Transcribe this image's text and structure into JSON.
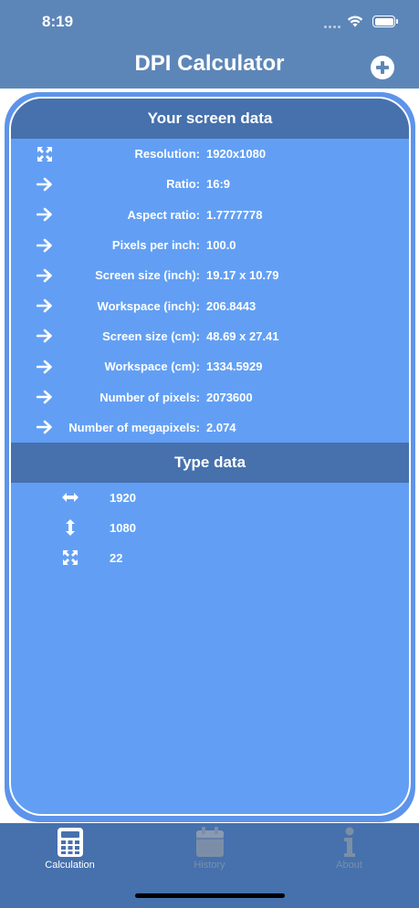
{
  "status_bar": {
    "time": "8:19"
  },
  "header": {
    "title": "DPI Calculator",
    "add_icon": "plus-circle-icon"
  },
  "screen_section": {
    "title": "Your screen data",
    "rows": [
      {
        "icon": "expand-icon",
        "label": "Resolution:",
        "value": "1920x1080"
      },
      {
        "icon": "arrow-right-icon",
        "label": "Ratio:",
        "value": "16:9"
      },
      {
        "icon": "arrow-right-icon",
        "label": "Aspect ratio:",
        "value": "1.7777778"
      },
      {
        "icon": "arrow-right-icon",
        "label": "Pixels per inch:",
        "value": "100.0"
      },
      {
        "icon": "arrow-right-icon",
        "label": "Screen size (inch):",
        "value": "19.17 x 10.79"
      },
      {
        "icon": "arrow-right-icon",
        "label": "Workspace (inch):",
        "value": "206.8443"
      },
      {
        "icon": "arrow-right-icon",
        "label": "Screen size (cm):",
        "value": "48.69 x 27.41"
      },
      {
        "icon": "arrow-right-icon",
        "label": "Workspace (cm):",
        "value": "1334.5929"
      },
      {
        "icon": "arrow-right-icon",
        "label": "Number of pixels:",
        "value": "2073600"
      },
      {
        "icon": "arrow-right-icon",
        "label": "Number of megapixels:",
        "value": "2.074"
      }
    ]
  },
  "type_section": {
    "title": "Type data",
    "rows": [
      {
        "icon": "horizontal-arrows-icon",
        "value": "1920"
      },
      {
        "icon": "vertical-arrows-icon",
        "value": "1080"
      },
      {
        "icon": "expand-icon",
        "value": "22"
      }
    ]
  },
  "tabbar": {
    "tabs": [
      {
        "label": "Calculation",
        "icon": "calculator-icon",
        "active": true
      },
      {
        "label": "History",
        "icon": "calendar-icon",
        "active": false
      },
      {
        "label": "About",
        "icon": "info-icon",
        "active": false
      }
    ]
  },
  "colors": {
    "header": "#5d86b8",
    "card": "#629ff4",
    "section_header": "#4671ad",
    "tabbar": "#4671ad",
    "inactive_tab": "#7c8ea7"
  }
}
